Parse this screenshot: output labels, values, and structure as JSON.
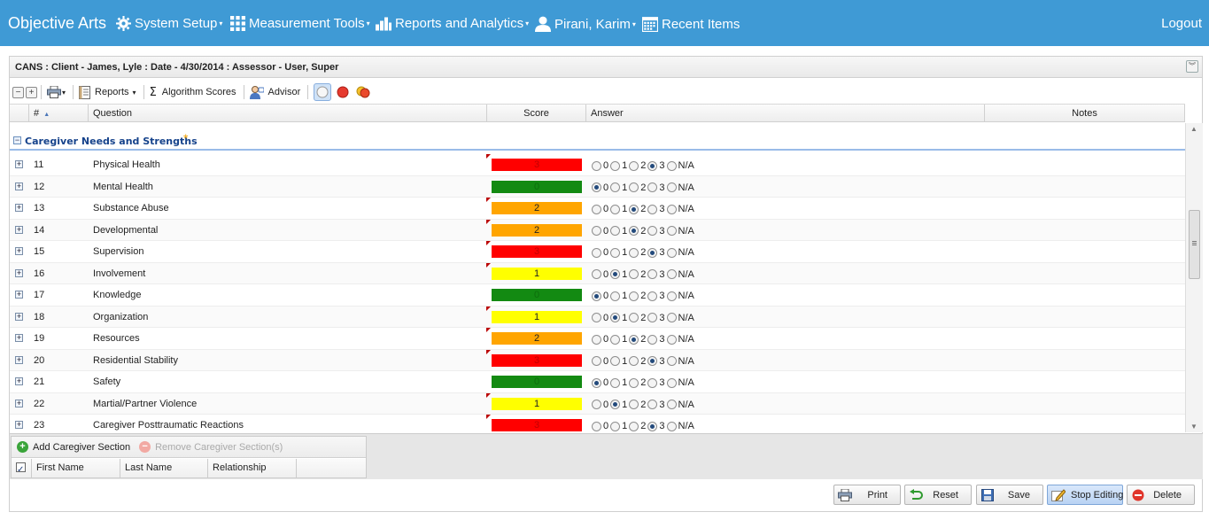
{
  "nav": {
    "brand": "Objective Arts",
    "items": [
      "System Setup",
      "Measurement Tools",
      "Reports and Analytics",
      "Pirani, Karim",
      "Recent Items"
    ],
    "logout": "Logout"
  },
  "panel": {
    "title": "CANS : Client - James, Lyle : Date - 4/30/2014 : Assessor - User, Super"
  },
  "toolbar": {
    "reports": "Reports",
    "algorithm_scores": "Algorithm Scores",
    "advisor": "Advisor"
  },
  "grid": {
    "headers": {
      "num": "#",
      "question": "Question",
      "score": "Score",
      "answer": "Answer",
      "notes": "Notes"
    },
    "group": {
      "title": "Caregiver Needs and Strengths",
      "marker": "*"
    },
    "answer_labels": [
      "0",
      "1",
      "2",
      "3",
      "N/A"
    ],
    "score_colors": {
      "0": "#138a12",
      "1": "#ffff00",
      "2": "#ffa500",
      "3": "#ff0000"
    },
    "rows": [
      {
        "num": "11",
        "question": "Physical Health",
        "score": "3",
        "selected": 3,
        "flag": true
      },
      {
        "num": "12",
        "question": "Mental Health",
        "score": "0",
        "selected": 0,
        "flag": false
      },
      {
        "num": "13",
        "question": "Substance Abuse",
        "score": "2",
        "selected": 2,
        "flag": true
      },
      {
        "num": "14",
        "question": "Developmental",
        "score": "2",
        "selected": 2,
        "flag": true
      },
      {
        "num": "15",
        "question": "Supervision",
        "score": "3",
        "selected": 3,
        "flag": true
      },
      {
        "num": "16",
        "question": "Involvement",
        "score": "1",
        "selected": 1,
        "flag": true
      },
      {
        "num": "17",
        "question": "Knowledge",
        "score": "0",
        "selected": 0,
        "flag": false
      },
      {
        "num": "18",
        "question": "Organization",
        "score": "1",
        "selected": 1,
        "flag": true
      },
      {
        "num": "19",
        "question": "Resources",
        "score": "2",
        "selected": 2,
        "flag": true
      },
      {
        "num": "20",
        "question": "Residential Stability",
        "score": "3",
        "selected": 3,
        "flag": true
      },
      {
        "num": "21",
        "question": "Safety",
        "score": "0",
        "selected": 0,
        "flag": false
      },
      {
        "num": "22",
        "question": "Martial/Partner Violence",
        "score": "1",
        "selected": 1,
        "flag": true
      },
      {
        "num": "23",
        "question": "Caregiver Posttraumatic Reactions",
        "score": "3",
        "selected": 3,
        "flag": true
      }
    ]
  },
  "caregiver": {
    "add": "Add Caregiver Section",
    "remove": "Remove Caregiver Section(s)",
    "columns": [
      "First Name",
      "Last Name",
      "Relationship"
    ]
  },
  "footer": {
    "print": "Print",
    "reset": "Reset",
    "save": "Save",
    "stop_editing": "Stop Editing",
    "delete": "Delete"
  }
}
